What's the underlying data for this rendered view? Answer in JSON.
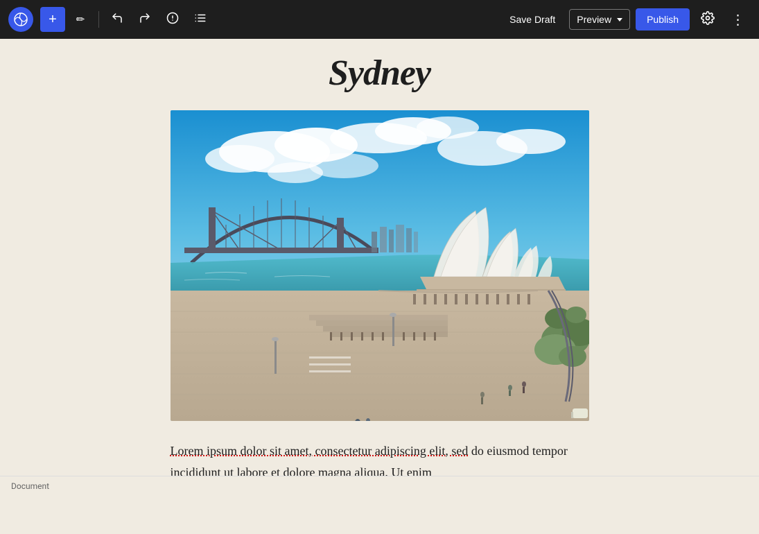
{
  "toolbar": {
    "wp_logo_label": "WordPress",
    "add_label": "+",
    "pen_label": "✏",
    "undo_label": "↩",
    "redo_label": "↪",
    "info_label": "ℹ",
    "list_view_label": "≡",
    "save_draft_label": "Save Draft",
    "preview_label": "Preview",
    "publish_label": "Publish",
    "settings_label": "⚙",
    "more_label": "⋮"
  },
  "editor": {
    "title": "Sydney",
    "image_alt": "Sydney Opera House and Harbour Bridge"
  },
  "content": {
    "paragraph1": "Lorem ipsum dolor sit amet, consectetur adipiscing elit, sed do eiusmod tempor incididunt ut labore et dolore magna aliqua. Ut enim"
  },
  "statusbar": {
    "label": "Document"
  }
}
